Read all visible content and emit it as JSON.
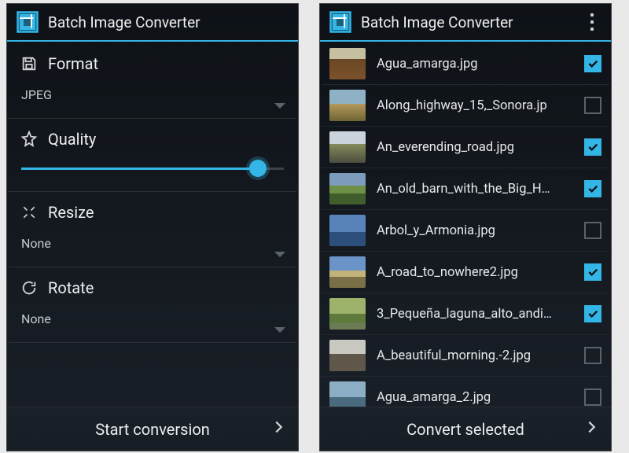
{
  "app": {
    "name": "Batch Image Converter"
  },
  "settings": {
    "format": {
      "label": "Format",
      "value": "JPEG"
    },
    "quality": {
      "label": "Quality",
      "percent": 90
    },
    "resize": {
      "label": "Resize",
      "value": "None"
    },
    "rotate": {
      "label": "Rotate",
      "value": "None"
    },
    "start_button": "Start conversion"
  },
  "filelist": {
    "items": [
      {
        "name": "Agua_amarga.jpg",
        "checked": true,
        "thumbClass": "th-sunset"
      },
      {
        "name": "Along_highway_15,_Sonora.jp",
        "checked": false,
        "thumbClass": "th-highway"
      },
      {
        "name": "An_everending_road.jpg",
        "checked": true,
        "thumbClass": "th-road"
      },
      {
        "name": "An_old_barn_with_the_Big_H…",
        "checked": true,
        "thumbClass": "th-barn"
      },
      {
        "name": "Arbol_y_Armonia.jpg",
        "checked": false,
        "thumbClass": "th-lake"
      },
      {
        "name": "A_road_to_nowhere2.jpg",
        "checked": true,
        "thumbClass": "th-nowhere"
      },
      {
        "name": "3_Pequeña_laguna_alto_andi…",
        "checked": true,
        "thumbClass": "th-laguna"
      },
      {
        "name": "A_beautiful_morning.-2.jpg",
        "checked": false,
        "thumbClass": "th-morning"
      },
      {
        "name": "Agua_amarga_2.jpg",
        "checked": false,
        "thumbClass": "th-default"
      }
    ],
    "convert_button": "Convert selected"
  },
  "icons": {
    "app": "crop-icon",
    "overflow": "overflow-icon",
    "format": "save-icon",
    "quality": "star-icon",
    "resize": "collapse-icon",
    "rotate": "rotate-icon",
    "chevron": "chevron-right-icon",
    "check": "check-icon"
  }
}
